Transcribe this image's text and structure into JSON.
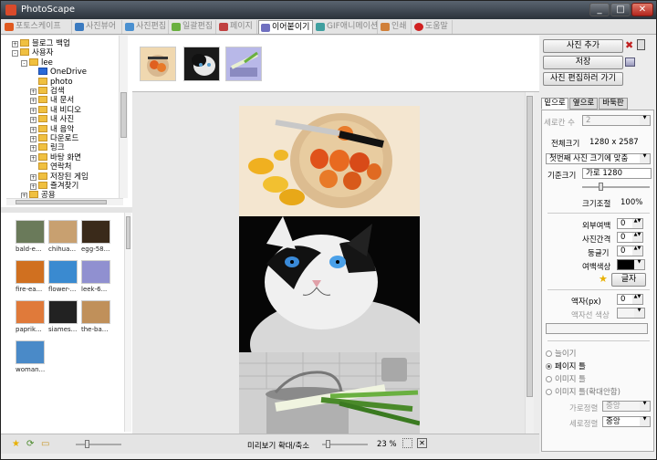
{
  "window": {
    "title": "PhotoScape",
    "min": "_",
    "max": "□",
    "close": "✕"
  },
  "tabs": [
    {
      "label": "포토스케이프",
      "icon": "photoscape-icon",
      "color": "#e05a20"
    },
    {
      "label": "사진뷰어",
      "icon": "viewer-icon",
      "color": "#3a7ac0"
    },
    {
      "label": "사진편집",
      "icon": "editor-icon",
      "color": "#4a90d0"
    },
    {
      "label": "일괄편집",
      "icon": "batch-icon",
      "color": "#6ab040"
    },
    {
      "label": "페이지",
      "icon": "page-icon",
      "color": "#c04040"
    },
    {
      "label": "이어붙이기",
      "icon": "combine-icon",
      "color": "#7070c0"
    },
    {
      "label": "GIF애니메이션",
      "icon": "gif-icon",
      "color": "#40a0a0"
    },
    {
      "label": "인쇄",
      "icon": "print-icon",
      "color": "#d0803a"
    },
    {
      "label": "도움말",
      "icon": "help-icon",
      "color": "#d02020"
    }
  ],
  "tree": [
    {
      "label": "블로그 백업",
      "depth": 1,
      "exp": "+"
    },
    {
      "label": "사용자",
      "depth": 1,
      "exp": "-"
    },
    {
      "label": "lee",
      "depth": 2,
      "exp": "-"
    },
    {
      "label": "OneDrive",
      "depth": 3,
      "exp": ""
    },
    {
      "label": "photo",
      "depth": 3,
      "exp": ""
    },
    {
      "label": "검색",
      "depth": 3,
      "exp": "+"
    },
    {
      "label": "내 문서",
      "depth": 3,
      "exp": "+"
    },
    {
      "label": "내 비디오",
      "depth": 3,
      "exp": "+"
    },
    {
      "label": "내 사진",
      "depth": 3,
      "exp": "+"
    },
    {
      "label": "내 음악",
      "depth": 3,
      "exp": "+"
    },
    {
      "label": "다운로드",
      "depth": 3,
      "exp": "+"
    },
    {
      "label": "링크",
      "depth": 3,
      "exp": "+"
    },
    {
      "label": "바탕 화면",
      "depth": 3,
      "exp": "+"
    },
    {
      "label": "연락처",
      "depth": 3,
      "exp": ""
    },
    {
      "label": "저장된 게임",
      "depth": 3,
      "exp": "+"
    },
    {
      "label": "즐겨찾기",
      "depth": 3,
      "exp": "+"
    },
    {
      "label": "공용",
      "depth": 2,
      "exp": "+"
    }
  ],
  "thumbnails": [
    {
      "label": "bald-e...",
      "color": "#6a7a5a"
    },
    {
      "label": "chihua...",
      "color": "#c8a070"
    },
    {
      "label": "egg-58...",
      "color": "#3a2a1a"
    },
    {
      "label": "fire-ea...",
      "color": "#d07020"
    },
    {
      "label": "flower-...",
      "color": "#3a8ad0"
    },
    {
      "label": "leek-6...",
      "color": "#9090d0"
    },
    {
      "label": "paprik...",
      "color": "#e07a3a"
    },
    {
      "label": "siames...",
      "color": "#222222"
    },
    {
      "label": "the-ba...",
      "color": "#c0905a"
    },
    {
      "label": "woman...",
      "color": "#4a8ac8"
    }
  ],
  "strip": [
    {
      "name": "strip-thumb-paprika",
      "color": "#e07a3a"
    },
    {
      "name": "strip-thumb-cat",
      "color": "#222222"
    },
    {
      "name": "strip-thumb-leek",
      "color": "#9090d0"
    }
  ],
  "bottom": {
    "preview_label": "미리보기 확대/축소",
    "zoom": "23 %"
  },
  "right": {
    "add_photo": "사진 추가",
    "save": "저장",
    "goto_editor": "사진 편집하러 가기",
    "tabs": [
      "밑으로",
      "옆으로",
      "바둑판"
    ],
    "column_count_label": "세로칸 수",
    "column_count_value": "2",
    "total_size_label": "전체크기",
    "total_size_value": "1280 x 2587",
    "fit_select": "첫번째 사진 크기에 맞춤",
    "base_size_label": "기준크기",
    "base_size_value": "가로 1280",
    "adjust_label": "크기조절",
    "adjust_value": "100%",
    "outer_margin_label": "외부여백",
    "outer_margin_value": "0",
    "spacing_label": "사진간격",
    "spacing_value": "0",
    "rounded_label": "둥글기",
    "rounded_value": "0",
    "margin_color_label": "여백색상",
    "margin_color": "#000000",
    "text_button": "글자",
    "frame_line_label": "액자(px)",
    "frame_line_value": "0",
    "frame_color_label": "액자선 색상",
    "radio_stretch": "늘이기",
    "radio_fill_page": "페이지 틀",
    "radio_fill_image": "이미지 틀",
    "radio_fill_image_zoom": "이미지 틀(확대안함)",
    "halign_label": "가로정렬",
    "halign_value": "중앙",
    "valign_label": "세로정렬",
    "valign_value": "중앙"
  }
}
